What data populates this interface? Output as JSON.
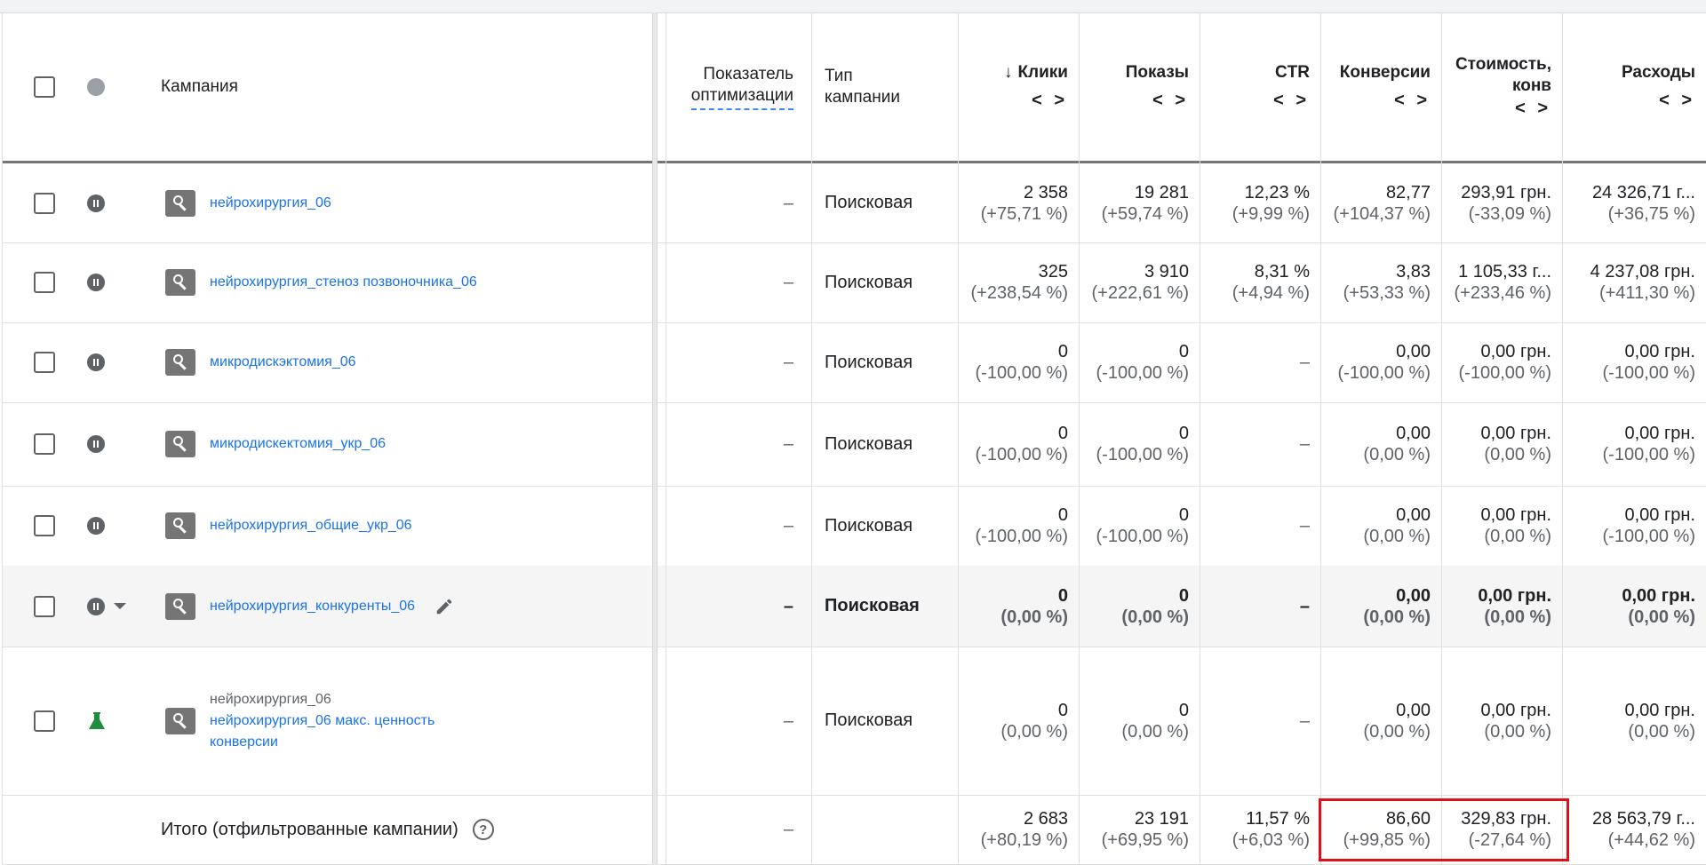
{
  "header": {
    "campaign": "Кампания",
    "opt_score": "Показатель оптимизации",
    "type_line1": "Тип",
    "type_line2": "кампании",
    "clicks": "Клики",
    "impressions": "Показы",
    "ctr": "CTR",
    "conversions": "Конверсии",
    "cost_conv_line1": "Стоимость,",
    "cost_conv_line2": "конв",
    "cost": "Расходы",
    "sort_arrow": "↓",
    "expand_arrows": "< >"
  },
  "rows": [
    {
      "name": "нейрохирургия_06",
      "opt": "–",
      "type": "Поисковая",
      "clicks": "2 358",
      "clicks_d": "(+75,71 %)",
      "impr": "19 281",
      "impr_d": "(+59,74 %)",
      "ctr": "12,23 %",
      "ctr_d": "(+9,99 %)",
      "conv": "82,77",
      "conv_d": "(+104,37 %)",
      "cpc": "293,91 грн.",
      "cpc_d": "(-33,09 %)",
      "cost": "24 326,71 г...",
      "cost_d": "(+36,75 %)"
    },
    {
      "name": "нейрохирургия_стеноз позвоночника_06",
      "opt": "–",
      "type": "Поисковая",
      "clicks": "325",
      "clicks_d": "(+238,54 %)",
      "impr": "3 910",
      "impr_d": "(+222,61 %)",
      "ctr": "8,31 %",
      "ctr_d": "(+4,94 %)",
      "conv": "3,83",
      "conv_d": "(+53,33 %)",
      "cpc": "1 105,33 г...",
      "cpc_d": "(+233,46 %)",
      "cost": "4 237,08 грн.",
      "cost_d": "(+411,30 %)"
    },
    {
      "name": "микродискэктомия_06",
      "opt": "–",
      "type": "Поисковая",
      "clicks": "0",
      "clicks_d": "(-100,00 %)",
      "impr": "0",
      "impr_d": "(-100,00 %)",
      "ctr": "–",
      "ctr_d": "",
      "conv": "0,00",
      "conv_d": "(-100,00 %)",
      "cpc": "0,00 грн.",
      "cpc_d": "(-100,00 %)",
      "cost": "0,00 грн.",
      "cost_d": "(-100,00 %)"
    },
    {
      "name": "микродискектомия_укр_06",
      "opt": "–",
      "type": "Поисковая",
      "clicks": "0",
      "clicks_d": "(-100,00 %)",
      "impr": "0",
      "impr_d": "(-100,00 %)",
      "ctr": "–",
      "ctr_d": "",
      "conv": "0,00",
      "conv_d": "(0,00 %)",
      "cpc": "0,00 грн.",
      "cpc_d": "(0,00 %)",
      "cost": "0,00 грн.",
      "cost_d": "(-100,00 %)"
    },
    {
      "name": "нейрохирургия_общие_укр_06",
      "opt": "–",
      "type": "Поисковая",
      "clicks": "0",
      "clicks_d": "(-100,00 %)",
      "impr": "0",
      "impr_d": "(-100,00 %)",
      "ctr": "–",
      "ctr_d": "",
      "conv": "0,00",
      "conv_d": "(0,00 %)",
      "cpc": "0,00 грн.",
      "cpc_d": "(0,00 %)",
      "cost": "0,00 грн.",
      "cost_d": "(-100,00 %)"
    },
    {
      "name": "нейрохирургия_конкуренты_06",
      "opt": "–",
      "type": "Поисковая",
      "clicks": "0",
      "clicks_d": "(0,00 %)",
      "impr": "0",
      "impr_d": "(0,00 %)",
      "ctr": "–",
      "ctr_d": "",
      "conv": "0,00",
      "conv_d": "(0,00 %)",
      "cpc": "0,00 грн.",
      "cpc_d": "(0,00 %)",
      "cost": "0,00 грн.",
      "cost_d": "(0,00 %)"
    },
    {
      "name_top": "нейрохирургия_06",
      "name": "нейрохирургия_06 макс. ценность",
      "name_cont": "конверсии",
      "opt": "–",
      "type": "Поисковая",
      "clicks": "0",
      "clicks_d": "(0,00 %)",
      "impr": "0",
      "impr_d": "(0,00 %)",
      "ctr": "–",
      "ctr_d": "",
      "conv": "0,00",
      "conv_d": "(0,00 %)",
      "cpc": "0,00 грн.",
      "cpc_d": "(0,00 %)",
      "cost": "0,00 грн.",
      "cost_d": "(0,00 %)"
    }
  ],
  "total": {
    "label": "Итого (отфильтрованные кампании)",
    "help": "?",
    "opt": "–",
    "clicks": "2 683",
    "clicks_d": "(+80,19 %)",
    "impr": "23 191",
    "impr_d": "(+69,95 %)",
    "ctr": "11,57 %",
    "ctr_d": "(+6,03 %)",
    "conv": "86,60",
    "conv_d": "(+99,85 %)",
    "cpc": "329,83 грн.",
    "cpc_d": "(-27,64 %)",
    "cost": "28 563,79 г...",
    "cost_d": "(+44,62 %)"
  },
  "colors": {
    "link": "#1a73e8",
    "highlight": "#e0101a",
    "experiment": "#1e8e3e"
  }
}
